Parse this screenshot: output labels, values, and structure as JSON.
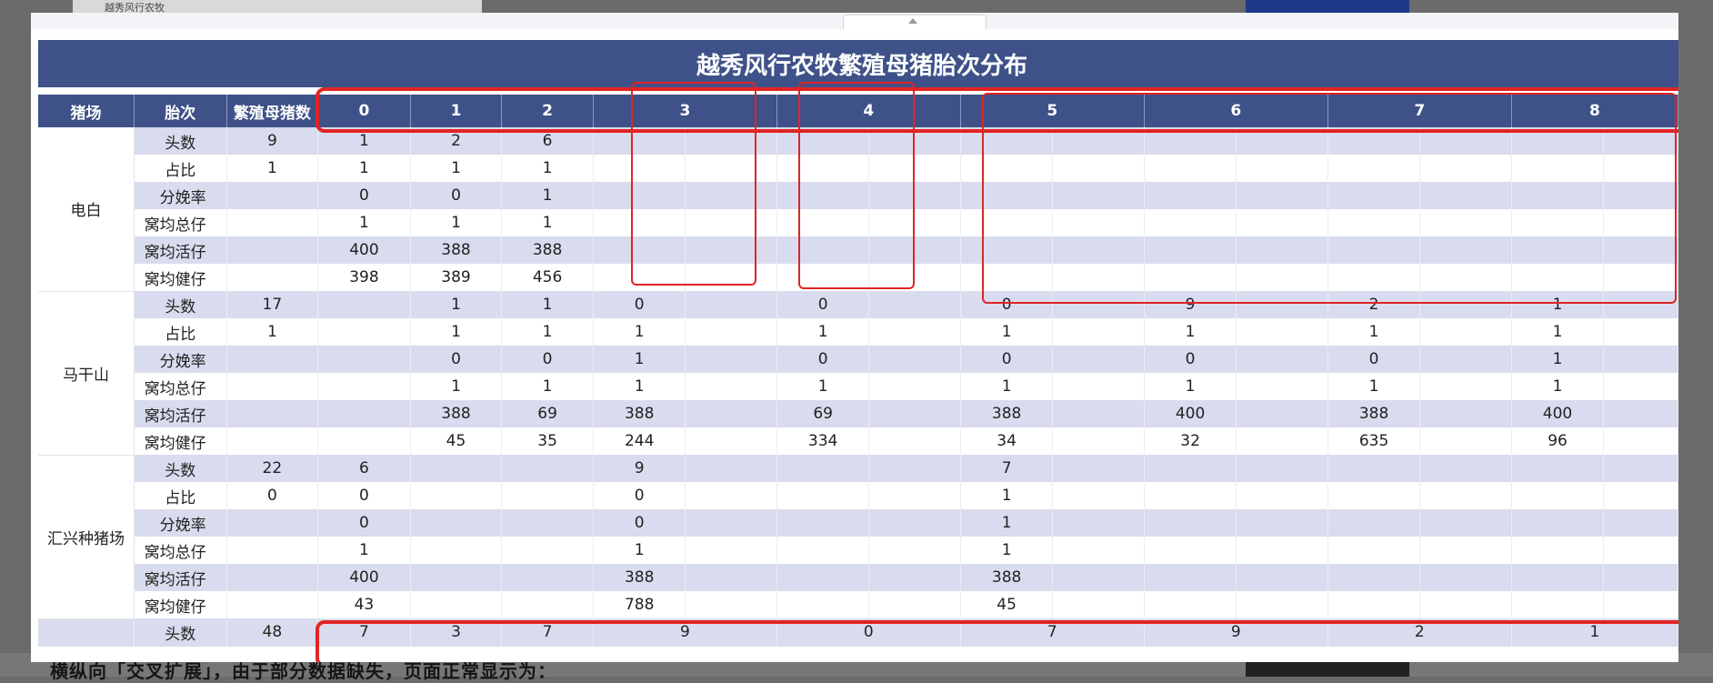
{
  "background": {
    "top_text": "越秀风行农牧",
    "bottom_text": "横纵向「交叉扩展」，由于部分数据缺失，页面正常显示为："
  },
  "title": "越秀风行农牧繁殖母猪胎次分布",
  "headers": {
    "farm": "猪场",
    "parity": "胎次",
    "sow_count": "繁殖母猪数",
    "cols": [
      "0",
      "1",
      "2",
      "3",
      "4",
      "5",
      "6",
      "7",
      "8"
    ]
  },
  "farms": [
    {
      "name": "电白",
      "rows": [
        {
          "metric": "头数",
          "total": "9",
          "cells": [
            "1",
            "2",
            "6",
            "",
            "",
            "",
            "",
            "",
            "",
            "",
            "",
            "",
            "",
            "",
            ""
          ]
        },
        {
          "metric": "占比",
          "total": "1",
          "cells": [
            "1",
            "1",
            "1",
            "",
            "",
            "",
            "",
            "",
            "",
            "",
            "",
            "",
            "",
            "",
            ""
          ]
        },
        {
          "metric": "分娩率",
          "total": "",
          "cells": [
            "0",
            "0",
            "1",
            "",
            "",
            "",
            "",
            "",
            "",
            "",
            "",
            "",
            "",
            "",
            ""
          ]
        },
        {
          "metric": "窝均总仔",
          "total": "",
          "cells": [
            "1",
            "1",
            "1",
            "",
            "",
            "",
            "",
            "",
            "",
            "",
            "",
            "",
            "",
            "",
            ""
          ]
        },
        {
          "metric": "窝均活仔",
          "total": "",
          "cells": [
            "400",
            "388",
            "388",
            "",
            "",
            "",
            "",
            "",
            "",
            "",
            "",
            "",
            "",
            "",
            ""
          ]
        },
        {
          "metric": "窝均健仔",
          "total": "",
          "cells": [
            "398",
            "389",
            "456",
            "",
            "",
            "",
            "",
            "",
            "",
            "",
            "",
            "",
            "",
            "",
            ""
          ]
        }
      ]
    },
    {
      "name": "马干山",
      "rows": [
        {
          "metric": "头数",
          "total": "17",
          "cells": [
            "",
            "1",
            "1",
            "0",
            "",
            "0",
            "",
            "0",
            "",
            "9",
            "",
            "2",
            "",
            "1",
            ""
          ]
        },
        {
          "metric": "占比",
          "total": "1",
          "cells": [
            "",
            "1",
            "1",
            "1",
            "",
            "1",
            "",
            "1",
            "",
            "1",
            "",
            "1",
            "",
            "1",
            ""
          ]
        },
        {
          "metric": "分娩率",
          "total": "",
          "cells": [
            "",
            "0",
            "0",
            "1",
            "",
            "0",
            "",
            "0",
            "",
            "0",
            "",
            "0",
            "",
            "1",
            ""
          ]
        },
        {
          "metric": "窝均总仔",
          "total": "",
          "cells": [
            "",
            "1",
            "1",
            "1",
            "",
            "1",
            "",
            "1",
            "",
            "1",
            "",
            "1",
            "",
            "1",
            ""
          ]
        },
        {
          "metric": "窝均活仔",
          "total": "",
          "cells": [
            "",
            "388",
            "69",
            "388",
            "",
            "69",
            "",
            "388",
            "",
            "400",
            "",
            "388",
            "",
            "400",
            ""
          ]
        },
        {
          "metric": "窝均健仔",
          "total": "",
          "cells": [
            "",
            "45",
            "35",
            "244",
            "",
            "334",
            "",
            "34",
            "",
            "32",
            "",
            "635",
            "",
            "96",
            ""
          ]
        }
      ]
    },
    {
      "name": "汇兴种猪场",
      "rows": [
        {
          "metric": "头数",
          "total": "22",
          "cells": [
            "6",
            "",
            "",
            "9",
            "",
            "",
            "",
            "7",
            "",
            "",
            "",
            "",
            "",
            "",
            ""
          ]
        },
        {
          "metric": "占比",
          "total": "0",
          "cells": [
            "0",
            "",
            "",
            "0",
            "",
            "",
            "",
            "1",
            "",
            "",
            "",
            "",
            "",
            "",
            ""
          ]
        },
        {
          "metric": "分娩率",
          "total": "",
          "cells": [
            "0",
            "",
            "",
            "0",
            "",
            "",
            "",
            "1",
            "",
            "",
            "",
            "",
            "",
            "",
            ""
          ]
        },
        {
          "metric": "窝均总仔",
          "total": "",
          "cells": [
            "1",
            "",
            "",
            "1",
            "",
            "",
            "",
            "1",
            "",
            "",
            "",
            "",
            "",
            "",
            ""
          ]
        },
        {
          "metric": "窝均活仔",
          "total": "",
          "cells": [
            "400",
            "",
            "",
            "388",
            "",
            "",
            "",
            "388",
            "",
            "",
            "",
            "",
            "",
            "",
            ""
          ]
        },
        {
          "metric": "窝均健仔",
          "total": "",
          "cells": [
            "43",
            "",
            "",
            "788",
            "",
            "",
            "",
            "45",
            "",
            "",
            "",
            "",
            "",
            "",
            ""
          ]
        }
      ]
    }
  ],
  "total_row": {
    "metric": "头数",
    "total": "48",
    "cells": [
      "7",
      "3",
      "7",
      "9",
      "0",
      "7",
      "9",
      "2",
      "1"
    ]
  }
}
